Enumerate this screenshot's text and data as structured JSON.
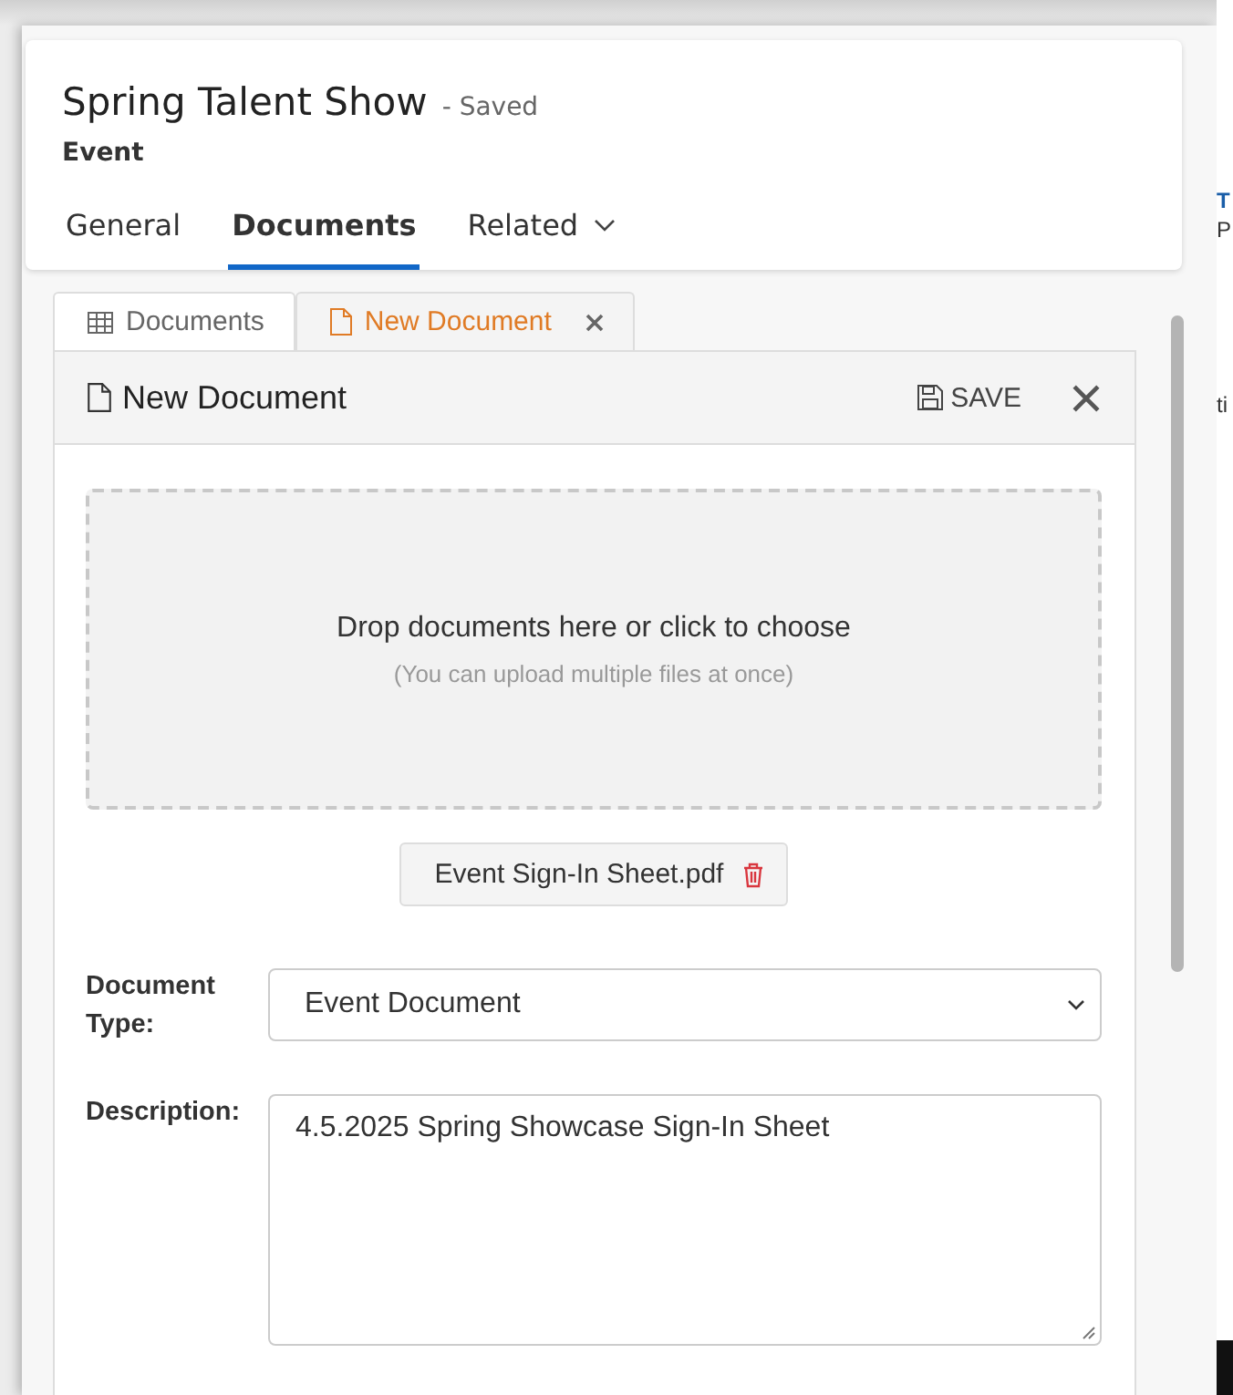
{
  "record": {
    "title": "Spring Talent Show",
    "status": "- Saved",
    "entity": "Event"
  },
  "form_tabs": [
    {
      "label": "General",
      "selected": false,
      "kind": "plain"
    },
    {
      "label": "Documents",
      "selected": true,
      "kind": "plain"
    },
    {
      "label": "Related",
      "selected": false,
      "kind": "menu"
    }
  ],
  "pane_tabs": [
    {
      "label": "Documents",
      "kind": "list",
      "selected": false
    },
    {
      "label": "New Document",
      "kind": "editor",
      "selected": true
    }
  ],
  "panel": {
    "title": "New Document",
    "save": "SAVE"
  },
  "dropzone": {
    "text": "Drop documents here or click to choose",
    "hint": "(You can upload multiple files at once)"
  },
  "files": [
    {
      "name": "Event Sign-In Sheet.pdf"
    }
  ],
  "fields": [
    {
      "kind": "select",
      "label": "Document Type:",
      "value": "Event Document"
    },
    {
      "kind": "textarea",
      "label": "Description:",
      "value": "4.5.2025 Spring Showcase Sign-In Sheet"
    }
  ],
  "background": {
    "texts": [
      {
        "text": "T",
        "kind": "link"
      },
      {
        "text": "P",
        "kind": "plain"
      },
      {
        "text": "ti",
        "kind": "plain"
      }
    ]
  }
}
